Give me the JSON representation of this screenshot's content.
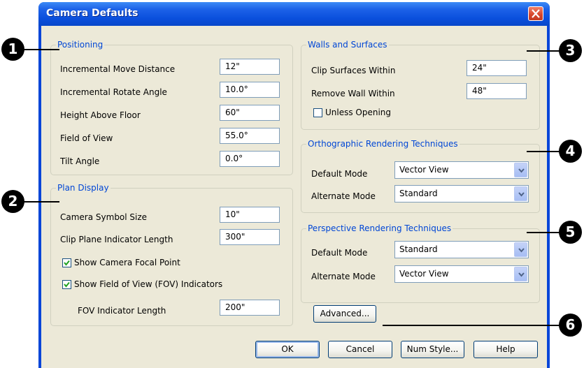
{
  "dialog": {
    "title": "Camera Defaults"
  },
  "positioning": {
    "legend": "Positioning",
    "incremental_move_distance": {
      "label": "Incremental Move Distance",
      "value": "12\""
    },
    "incremental_rotate_angle": {
      "label": "Incremental Rotate Angle",
      "value": "10.0°"
    },
    "height_above_floor": {
      "label": "Height Above Floor",
      "value": "60\""
    },
    "field_of_view": {
      "label": "Field of View",
      "value": "55.0°"
    },
    "tilt_angle": {
      "label": "Tilt Angle",
      "value": "0.0°"
    }
  },
  "plan_display": {
    "legend": "Plan Display",
    "camera_symbol_size": {
      "label": "Camera Symbol Size",
      "value": "10\""
    },
    "clip_plane_indicator_length": {
      "label": "Clip Plane Indicator Length",
      "value": "300\""
    },
    "show_camera_focal_point": {
      "label": "Show Camera Focal Point",
      "checked": true
    },
    "show_fov_indicators": {
      "label": "Show Field of View (FOV) Indicators",
      "checked": true
    },
    "fov_indicator_length": {
      "label": "FOV Indicator Length",
      "value": "200\""
    }
  },
  "walls_and_surfaces": {
    "legend": "Walls and Surfaces",
    "clip_surfaces_within": {
      "label": "Clip Surfaces Within",
      "value": "24\""
    },
    "remove_wall_within": {
      "label": "Remove Wall Within",
      "value": "48\""
    },
    "unless_opening": {
      "label": "Unless Opening",
      "checked": false
    }
  },
  "orthographic": {
    "legend": "Orthographic Rendering Techniques",
    "default_mode": {
      "label": "Default Mode",
      "value": "Vector View"
    },
    "alternate_mode": {
      "label": "Alternate Mode",
      "value": "Standard"
    }
  },
  "perspective": {
    "legend": "Perspective Rendering Techniques",
    "default_mode": {
      "label": "Default Mode",
      "value": "Standard"
    },
    "alternate_mode": {
      "label": "Alternate Mode",
      "value": "Vector View"
    }
  },
  "buttons": {
    "advanced": "Advanced...",
    "ok": "OK",
    "cancel": "Cancel",
    "num_style": "Num Style...",
    "help": "Help"
  },
  "callouts": [
    "1",
    "2",
    "3",
    "4",
    "5",
    "6"
  ],
  "colors": {
    "title_bar": "#0a4fdc",
    "dialog_face": "#ece9d8",
    "group_legend": "#0046d5",
    "close_button": "#d6442a"
  }
}
